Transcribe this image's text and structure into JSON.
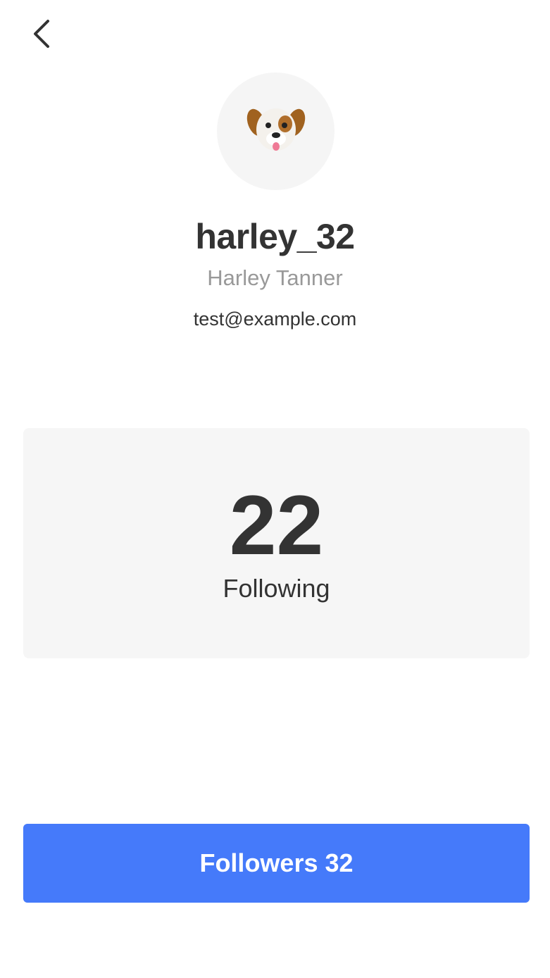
{
  "header": {
    "back_icon": "chevron-left-icon"
  },
  "profile": {
    "avatar_emoji": "🐶",
    "username": "harley_32",
    "full_name": "Harley Tanner",
    "email": "test@example.com"
  },
  "stats": {
    "following_count": "22",
    "following_label": "Following"
  },
  "actions": {
    "followers_button_label": "Followers 32"
  },
  "colors": {
    "accent": "#457afa",
    "card_background": "#f6f6f6",
    "secondary_text": "#999999",
    "primary_text": "#333333"
  }
}
